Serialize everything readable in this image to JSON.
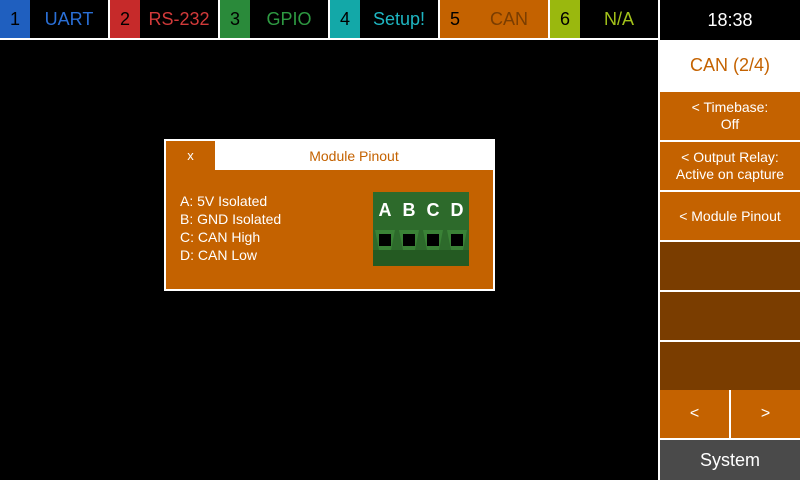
{
  "tabs": [
    {
      "num": "1",
      "label": "UART",
      "num_color": "#1f5fbf",
      "label_color": "#2a6fd6"
    },
    {
      "num": "2",
      "label": "RS-232",
      "num_color": "#c62a2a",
      "label_color": "#d23a3a"
    },
    {
      "num": "3",
      "label": "GPIO",
      "num_color": "#2a8a3a",
      "label_color": "#2e9a42"
    },
    {
      "num": "4",
      "label": "Setup!",
      "num_color": "#13a8a8",
      "label_color": "#1eb6c2"
    },
    {
      "num": "5",
      "label": "CAN",
      "num_color": "#c46200",
      "label_color": "#d06a00"
    },
    {
      "num": "6",
      "label": "N/A",
      "num_color": "#9ab80e",
      "label_color": "#a3c21a"
    }
  ],
  "clock": "18:38",
  "sidebar": {
    "title": "CAN (2/4)",
    "buttons": [
      {
        "line1": "< Timebase:",
        "line2": "Off"
      },
      {
        "line1": "< Output Relay:",
        "line2": "Active on capture"
      },
      {
        "line1": "< Module Pinout",
        "line2": ""
      }
    ],
    "prev": "<",
    "next": ">",
    "system": "System"
  },
  "dialog": {
    "close": "x",
    "title": "Module Pinout",
    "pins": [
      "A: 5V Isolated",
      "B: GND Isolated",
      "C: CAN High",
      "D: CAN Low"
    ],
    "connector_letters": [
      "A",
      "B",
      "C",
      "D"
    ]
  },
  "colors": {
    "accent": "#c46200",
    "accent_dark": "#7a3d00",
    "connector_green": "#2d6a2b"
  }
}
